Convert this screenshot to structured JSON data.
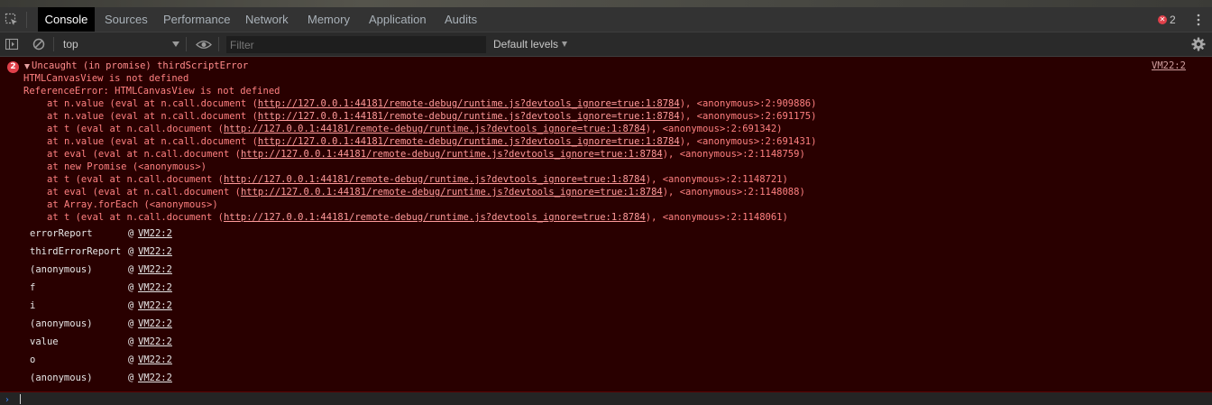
{
  "tabs": [
    {
      "label": "Console",
      "active": true
    },
    {
      "label": "Sources"
    },
    {
      "label": "Performance"
    },
    {
      "label": "Network"
    },
    {
      "label": "Memory"
    },
    {
      "label": "Application"
    },
    {
      "label": "Audits"
    }
  ],
  "error_count": "2",
  "toolbar": {
    "context": "top",
    "filter_placeholder": "Filter",
    "levels": "Default levels"
  },
  "error": {
    "badge_count": "2",
    "title": "Uncaught (in promise) thirdScriptError",
    "source": "VM22:2",
    "lines": [
      "HTMLCanvasView is not defined",
      "ReferenceError: HTMLCanvasView is not defined"
    ],
    "trace": [
      {
        "pre": "at n.value (eval at n.call.document (",
        "url": "http://127.0.0.1:44181/remote-debug/runtime.js?devtools_ignore=true:1:8784",
        "post": "), <anonymous>:2:909886)"
      },
      {
        "pre": "at n.value (eval at n.call.document (",
        "url": "http://127.0.0.1:44181/remote-debug/runtime.js?devtools_ignore=true:1:8784",
        "post": "), <anonymous>:2:691175)"
      },
      {
        "pre": "at t (eval at n.call.document (",
        "url": "http://127.0.0.1:44181/remote-debug/runtime.js?devtools_ignore=true:1:8784",
        "post": "), <anonymous>:2:691342)"
      },
      {
        "pre": "at n.value (eval at n.call.document (",
        "url": "http://127.0.0.1:44181/remote-debug/runtime.js?devtools_ignore=true:1:8784",
        "post": "), <anonymous>:2:691431)"
      },
      {
        "pre": "at eval (eval at n.call.document (",
        "url": "http://127.0.0.1:44181/remote-debug/runtime.js?devtools_ignore=true:1:8784",
        "post": "), <anonymous>:2:1148759)"
      },
      {
        "pre": "at new Promise (<anonymous>)",
        "url": "",
        "post": ""
      },
      {
        "pre": "at t (eval at n.call.document (",
        "url": "http://127.0.0.1:44181/remote-debug/runtime.js?devtools_ignore=true:1:8784",
        "post": "), <anonymous>:2:1148721)"
      },
      {
        "pre": "at eval (eval at n.call.document (",
        "url": "http://127.0.0.1:44181/remote-debug/runtime.js?devtools_ignore=true:1:8784",
        "post": "), <anonymous>:2:1148088)"
      },
      {
        "pre": "at Array.forEach (<anonymous>)",
        "url": "",
        "post": ""
      },
      {
        "pre": "at t (eval at n.call.document (",
        "url": "http://127.0.0.1:44181/remote-debug/runtime.js?devtools_ignore=true:1:8784",
        "post": "), <anonymous>:2:1148061)"
      }
    ],
    "stack": [
      {
        "fn": "errorReport",
        "link": "VM22:2"
      },
      {
        "fn": "thirdErrorReport",
        "link": "VM22:2"
      },
      {
        "fn": "(anonymous)",
        "link": "VM22:2"
      },
      {
        "fn": "f",
        "link": "VM22:2"
      },
      {
        "fn": "i",
        "link": "VM22:2"
      },
      {
        "fn": "(anonymous)",
        "link": "VM22:2"
      },
      {
        "fn": "value",
        "link": "VM22:2"
      },
      {
        "fn": "o",
        "link": "VM22:2"
      },
      {
        "fn": "(anonymous)",
        "link": "VM22:2"
      }
    ],
    "stack_at": "@"
  },
  "icons": {
    "inspect": "inspect-element-icon",
    "sidebar": "sidebar-toggle-icon",
    "clear": "clear-console-icon",
    "eye": "live-expression-eye-icon",
    "gear": "settings-gear-icon",
    "more": "more-options-icon",
    "prompt": "console-prompt-chevron-icon"
  },
  "colors": {
    "error_bg": "#290000",
    "error_text": "#ff8080",
    "badge": "#e0404a",
    "prompt": "#3b82f6"
  }
}
